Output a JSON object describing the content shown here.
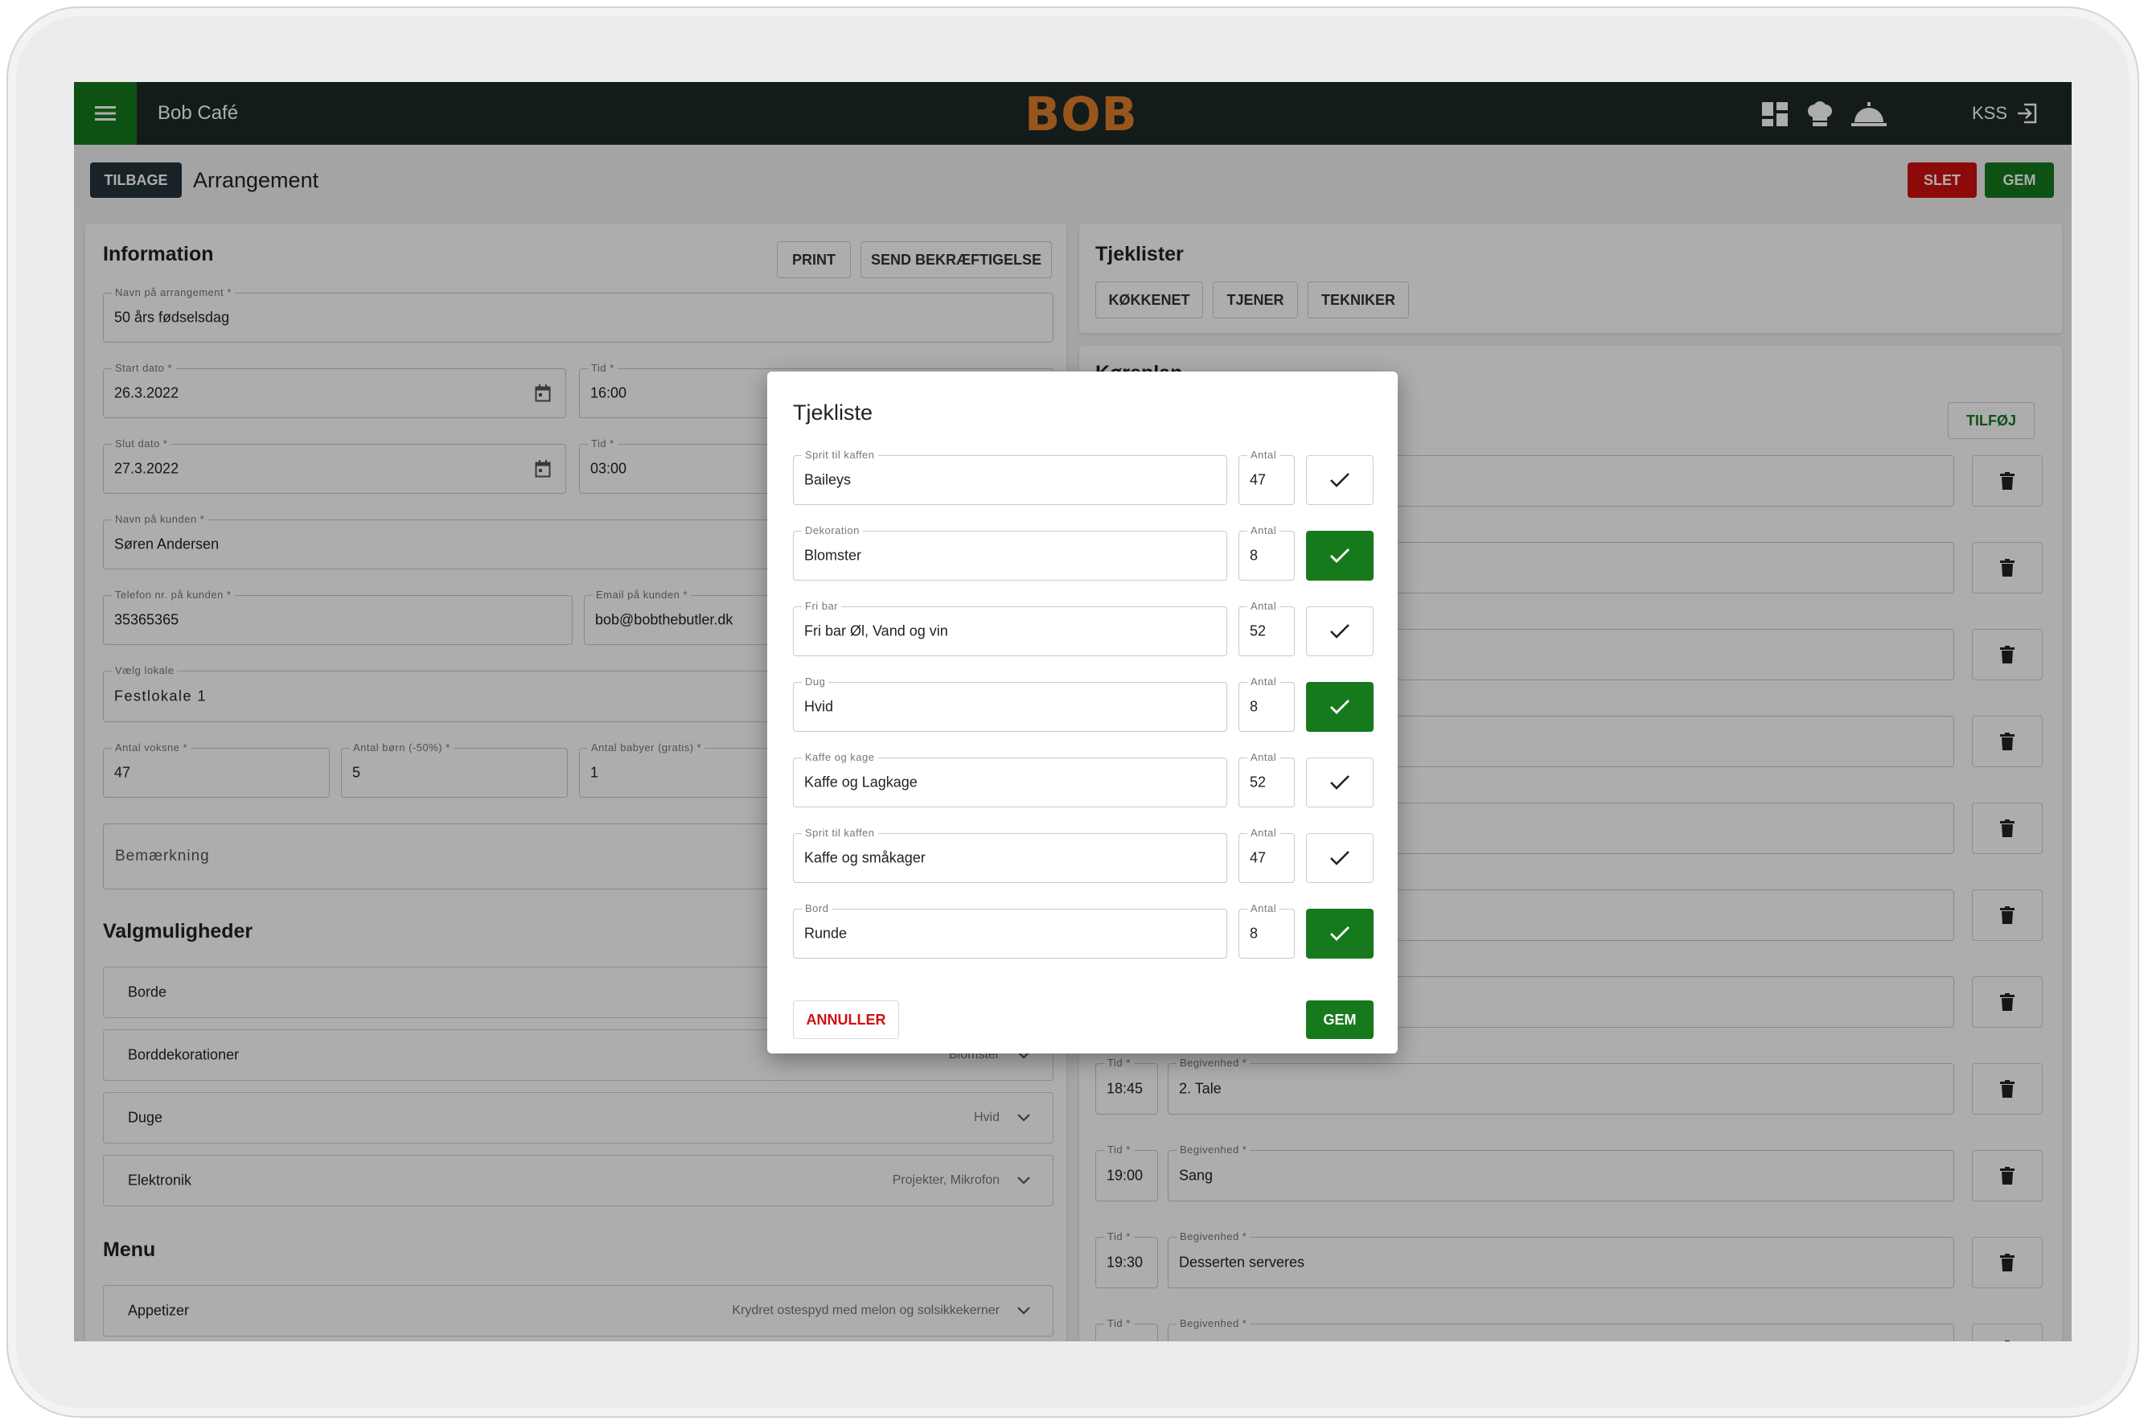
{
  "app": {
    "name": "Bob Café",
    "logo": "BOB",
    "user": "KSS"
  },
  "header": {
    "back_label": "TILBAGE",
    "title": "Arrangement",
    "delete_label": "SLET",
    "save_label": "GEM"
  },
  "information": {
    "title": "Information",
    "print_label": "PRINT",
    "send_label": "SEND BEKRÆFTIGELSE",
    "event_name": {
      "label": "Navn på arrangement *",
      "value": "50 års fødselsdag"
    },
    "start_date": {
      "label": "Start dato *",
      "value": "26.3.2022"
    },
    "start_time": {
      "label": "Tid *",
      "value": "16:00"
    },
    "end_date": {
      "label": "Slut dato *",
      "value": "27.3.2022"
    },
    "end_time": {
      "label": "Tid *",
      "value": "03:00"
    },
    "customer_name": {
      "label": "Navn på kunden *",
      "value": "Søren Andersen"
    },
    "phone": {
      "label": "Telefon nr. på kunden *",
      "value": "35365365"
    },
    "email": {
      "label": "Email på kunden *",
      "value": "bob@bobthebutler.dk"
    },
    "venue": {
      "label": "Vælg lokale",
      "value": "Festlokale 1"
    },
    "adults": {
      "label": "Antal voksne *",
      "value": "47"
    },
    "children": {
      "label": "Antal børn (-50%) *",
      "value": "5"
    },
    "babies": {
      "label": "Antal babyer (gratis) *",
      "value": "1"
    },
    "remark_placeholder": "Bemærkning"
  },
  "options": {
    "title": "Valgmuligheder",
    "items": [
      {
        "name": "Borde",
        "selected": ""
      },
      {
        "name": "Borddekorationer",
        "selected": "Blomster"
      },
      {
        "name": "Duge",
        "selected": "Hvid"
      },
      {
        "name": "Elektronik",
        "selected": "Projekter, Mikrofon"
      }
    ]
  },
  "menu": {
    "title": "Menu",
    "items": [
      {
        "name": "Appetizer",
        "selected": "Krydret ostespyd med melon og solsikkekerner"
      }
    ]
  },
  "checklists": {
    "title": "Tjeklister",
    "tabs": [
      "KØKKENET",
      "TJENER",
      "TEKNIKER"
    ]
  },
  "schedule": {
    "title": "Køreplan",
    "add_label": "TILFØJ",
    "time_label": "Tid *",
    "event_label": "Begivenhed *",
    "rows": [
      {
        "time": "18:45",
        "event": "2. Tale"
      },
      {
        "time": "19:00",
        "event": "Sang"
      },
      {
        "time": "19:30",
        "event": "Desserten serveres"
      },
      {
        "time": "",
        "event": ""
      }
    ]
  },
  "dialog": {
    "title": "Tjekliste",
    "qty_label": "Antal",
    "items": [
      {
        "label": "Sprit til kaffen",
        "value": "Baileys",
        "qty": "47",
        "checked": false
      },
      {
        "label": "Dekoration",
        "value": "Blomster",
        "qty": "8",
        "checked": true
      },
      {
        "label": "Fri bar",
        "value": "Fri bar Øl, Vand og vin",
        "qty": "52",
        "checked": false
      },
      {
        "label": "Dug",
        "value": "Hvid",
        "qty": "8",
        "checked": true
      },
      {
        "label": "Kaffe og kage",
        "value": "Kaffe og Lagkage",
        "qty": "52",
        "checked": false
      },
      {
        "label": "Sprit til kaffen",
        "value": "Kaffe og småkager",
        "qty": "47",
        "checked": false
      },
      {
        "label": "Bord",
        "value": "Runde",
        "qty": "8",
        "checked": true
      }
    ],
    "cancel_label": "ANNULLER",
    "save_label": "GEM"
  },
  "colors": {
    "topbar": "#1c2a27",
    "green": "#167a1c",
    "red": "#d01010",
    "logo": "#e07f2b"
  }
}
